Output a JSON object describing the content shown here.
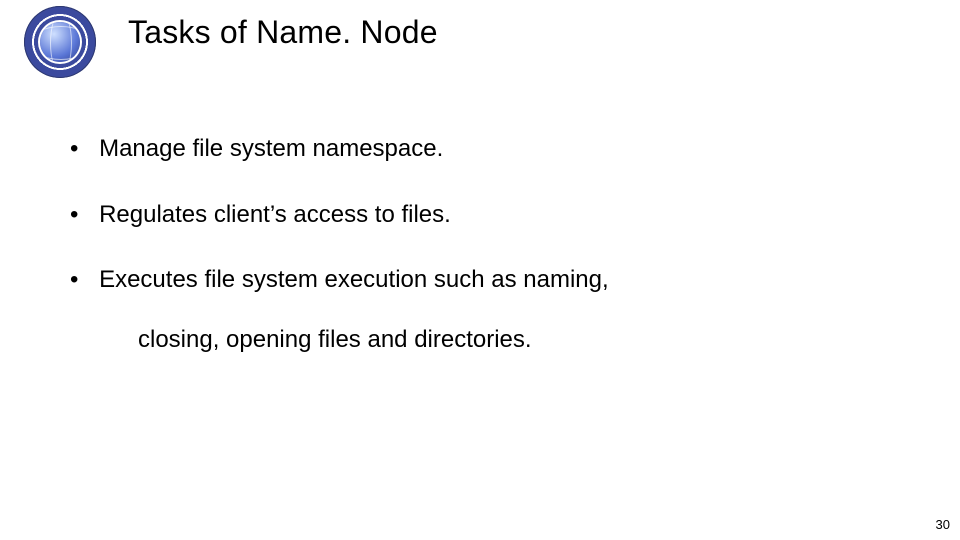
{
  "title": "Tasks of Name. Node",
  "bullets": [
    {
      "text": "Manage file system namespace."
    },
    {
      "text": "Regulates client’s access to files."
    },
    {
      "text": "Executes file system execution such as naming,",
      "cont": "closing, opening files and directories."
    }
  ],
  "pageNumber": "30",
  "logo": {
    "name": "university-seal-logo"
  }
}
